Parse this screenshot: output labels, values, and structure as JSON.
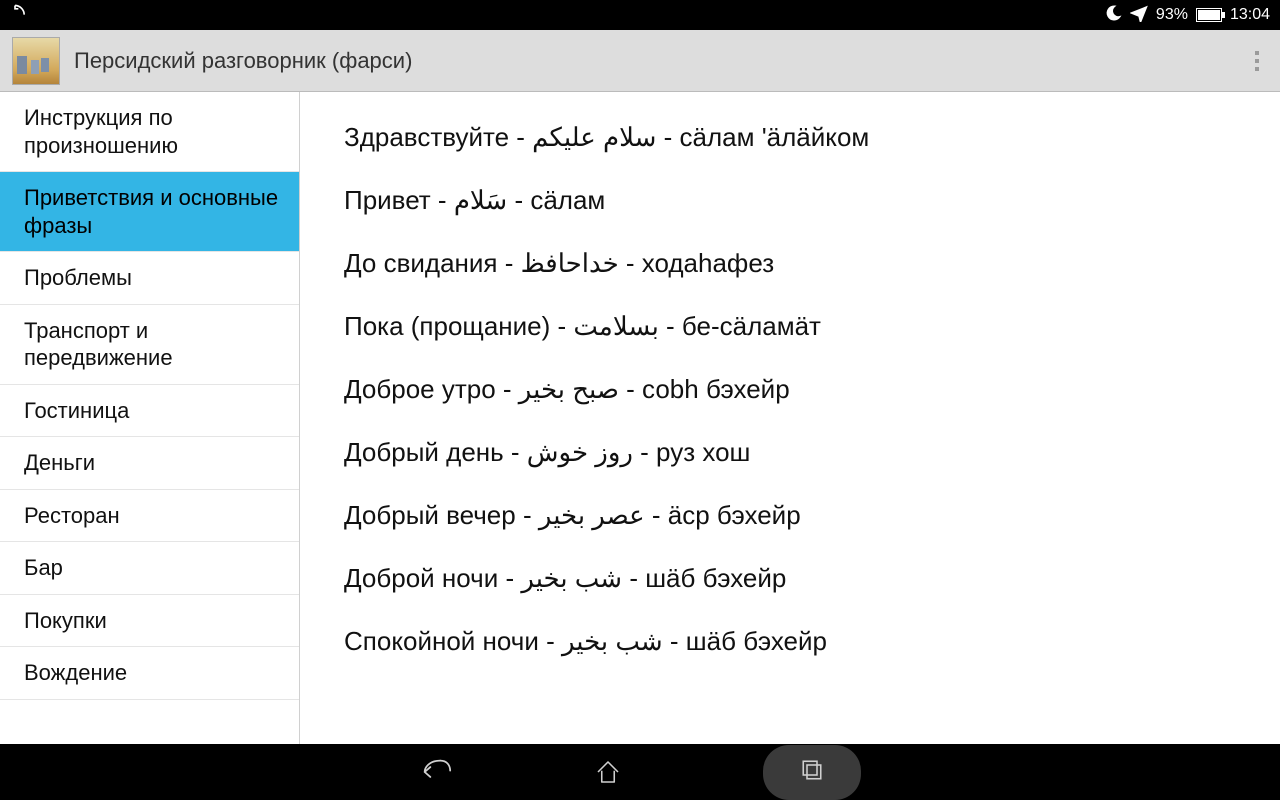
{
  "statusbar": {
    "battery_pct": "93%",
    "time": "13:04"
  },
  "actionbar": {
    "title": "Персидский разговорник (фарси)"
  },
  "sidebar": {
    "items": [
      {
        "label": "Инструкция по произношению",
        "active": false
      },
      {
        "label": "Приветствия и основные фразы",
        "active": true
      },
      {
        "label": "Проблемы",
        "active": false
      },
      {
        "label": "Транспорт и передвижение",
        "active": false
      },
      {
        "label": "Гостиница",
        "active": false
      },
      {
        "label": "Деньги",
        "active": false
      },
      {
        "label": "Ресторан",
        "active": false
      },
      {
        "label": "Бар",
        "active": false
      },
      {
        "label": "Покупки",
        "active": false
      },
      {
        "label": "Вождение",
        "active": false
      }
    ]
  },
  "content": {
    "phrases": [
      "Здравствуйте - سلام عليكم - сӓлам 'ӓлӓйком",
      "Привет - سَلام - сӓлам",
      "До свидания - خداحافظ - ходаhафез",
      "Пока (прощание) - بسلامت - бе-сӓламӓт",
      "Доброе утро - صبح بخير - соbh бэхейр",
      "Добрый день - روز خوش - руз хош",
      "Добрый вечер - عصر بخير - ӓср бэхейр",
      "Доброй ночи - شب بخير - шӓб бэхейр",
      "Спокойной ночи - شب بخير - шӓб бэхейр"
    ]
  }
}
